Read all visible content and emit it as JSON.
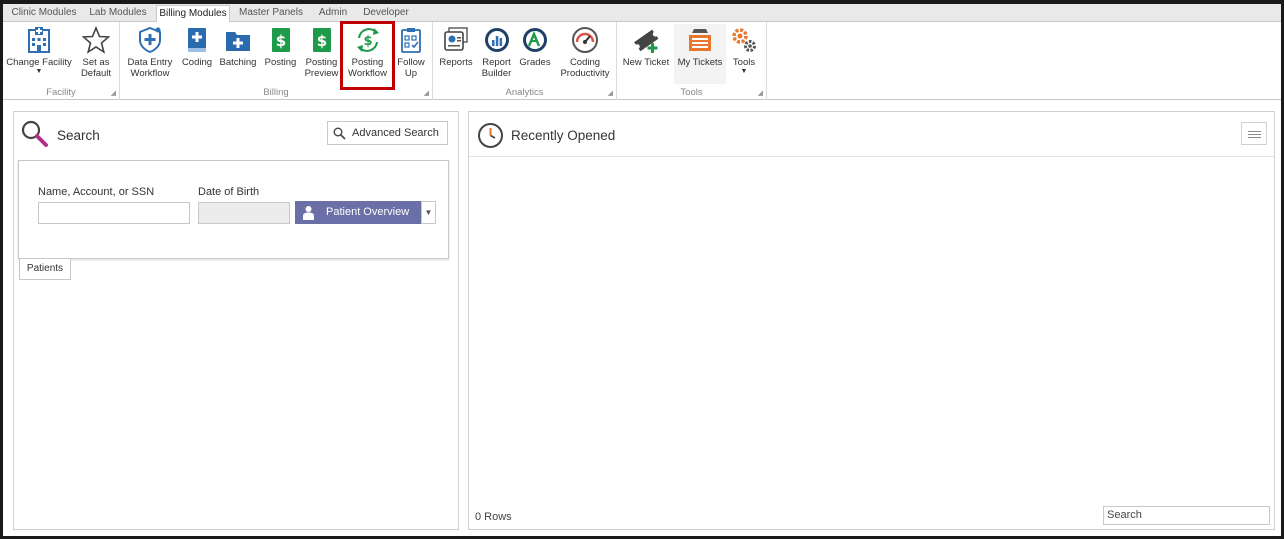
{
  "tabs": [
    "Clinic Modules",
    "Lab Modules",
    "Billing Modules",
    "Master Panels",
    "Admin",
    "Developer"
  ],
  "active_tab": "Billing Modules",
  "ribbon": {
    "facility": {
      "label": "Facility",
      "buttons": [
        {
          "label1": "Change Facility",
          "label2": "",
          "icon": "hospital-icon"
        },
        {
          "label1": "Set as",
          "label2": "Default",
          "icon": "star-icon"
        }
      ]
    },
    "billing": {
      "label": "Billing",
      "buttons": [
        {
          "label1": "Data Entry",
          "label2": "Workflow",
          "icon": "shield-workflow-icon"
        },
        {
          "label1": "Coding",
          "label2": "",
          "icon": "coding-book-icon"
        },
        {
          "label1": "Batching",
          "label2": "",
          "icon": "batching-folder-icon"
        },
        {
          "label1": "Posting",
          "label2": "",
          "icon": "dollar-icon"
        },
        {
          "label1": "Posting",
          "label2": "Preview",
          "icon": "dollar-preview-icon"
        },
        {
          "label1": "Posting",
          "label2": "Workflow",
          "icon": "dollar-cycle-icon"
        },
        {
          "label1": "Follow",
          "label2": "Up",
          "icon": "clipboard-check-icon"
        }
      ]
    },
    "analytics": {
      "label": "Analytics",
      "buttons": [
        {
          "label1": "Reports",
          "label2": "",
          "icon": "reports-icon"
        },
        {
          "label1": "Report",
          "label2": "Builder",
          "icon": "report-builder-icon"
        },
        {
          "label1": "Grades",
          "label2": "",
          "icon": "grades-icon"
        },
        {
          "label1": "Coding",
          "label2": "Productivity",
          "icon": "speedometer-icon"
        }
      ]
    },
    "tools": {
      "label": "Tools",
      "buttons": [
        {
          "label1": "New Ticket",
          "label2": "",
          "icon": "new-ticket-icon"
        },
        {
          "label1": "My Tickets",
          "label2": "",
          "icon": "tickets-stack-icon"
        },
        {
          "label1": "Tools",
          "label2": "",
          "icon": "gears-icon"
        }
      ]
    }
  },
  "search_panel": {
    "title": "Search",
    "advanced_search": "Advanced Search",
    "name_label": "Name, Account, or SSN",
    "dob_label": "Date of Birth",
    "patient_overview": "Patient Overview",
    "patients_tab": "Patients"
  },
  "recent_panel": {
    "title": "Recently Opened",
    "rows": "0 Rows",
    "search_placeholder": "Search"
  }
}
